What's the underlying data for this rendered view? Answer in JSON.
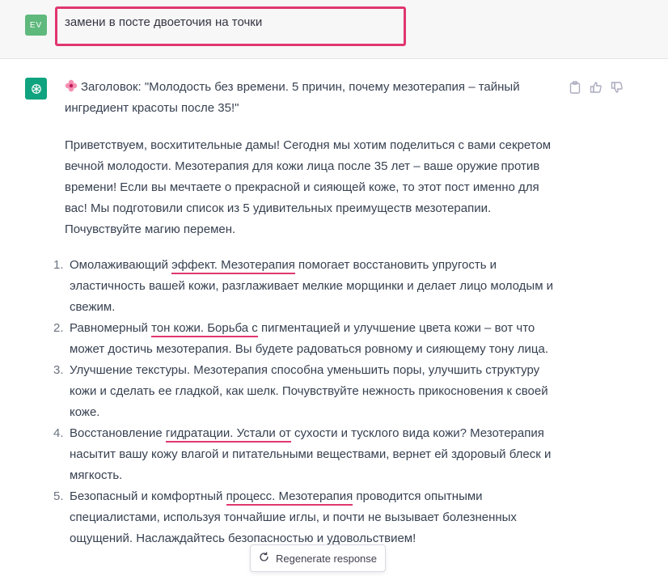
{
  "user": {
    "avatar_initials": "EV",
    "prompt": "замени в посте двоеточия на точки"
  },
  "assistant": {
    "title": "Заголовок: \"Молодость без времени. 5 причин, почему мезотерапия – тайный ингредиент красоты после 35!\"",
    "intro": "Приветствуем, восхитительные дамы! Сегодня мы хотим поделиться с вами секретом вечной молодости. Мезотерапия для кожи лица после 35 лет – ваше оружие против времени! Если вы мечтаете о прекрасной и сияющей коже, то этот пост именно для вас! Мы подготовили список из 5 удивительных преимуществ мезотерапии. Почувствуйте магию перемен.",
    "list": [
      {
        "num": "1.",
        "a": "Омолаживающий ",
        "u": "эффект. Мезотерапия",
        "b": " помогает восстановить упругость и эластичность вашей кожи, разглаживает мелкие морщинки и делает лицо молодым и свежим."
      },
      {
        "num": "2.",
        "a": "Равномерный ",
        "u": "тон кожи. Борьба с",
        "b": " пигментацией и улучшение цвета кожи – вот что может достичь мезотерапия. Вы будете радоваться ровному и сияющему тону лица."
      },
      {
        "num": "3.",
        "a": "Улучшение текстуры. Мезотерапия способна уменьшить поры, улучшить структуру кожи и сделать ее гладкой, как шелк. Почувствуйте нежность прикосновения к своей коже.",
        "u": "",
        "b": ""
      },
      {
        "num": "4.",
        "a": "Восстановление ",
        "u": "гидратации. Устали от",
        "b": " сухости и тусклого вида кожи? Мезотерапия насытит вашу кожу влагой и питательными веществами, вернет ей здоровый блеск и мягкость."
      },
      {
        "num": "5.",
        "a": "Безопасный и комфортный ",
        "u": "процесс. Мезотерапия",
        "b": " проводится опытными специалистами, используя тончайшие иглы, и почти не вызывает болезненных ощущений. Наслаждайтесь безопасностью и удовольствием!"
      }
    ]
  },
  "actions": {
    "icons": [
      "clipboard-icon",
      "thumbs-up-icon",
      "thumbs-down-icon"
    ]
  },
  "regenerate": {
    "label": "Regenerate response"
  },
  "colors": {
    "highlight": "#e0376e",
    "assistant_avatar": "#10a37f",
    "user_avatar": "#5fb87c",
    "user_row_bg": "#f7f7f8"
  }
}
